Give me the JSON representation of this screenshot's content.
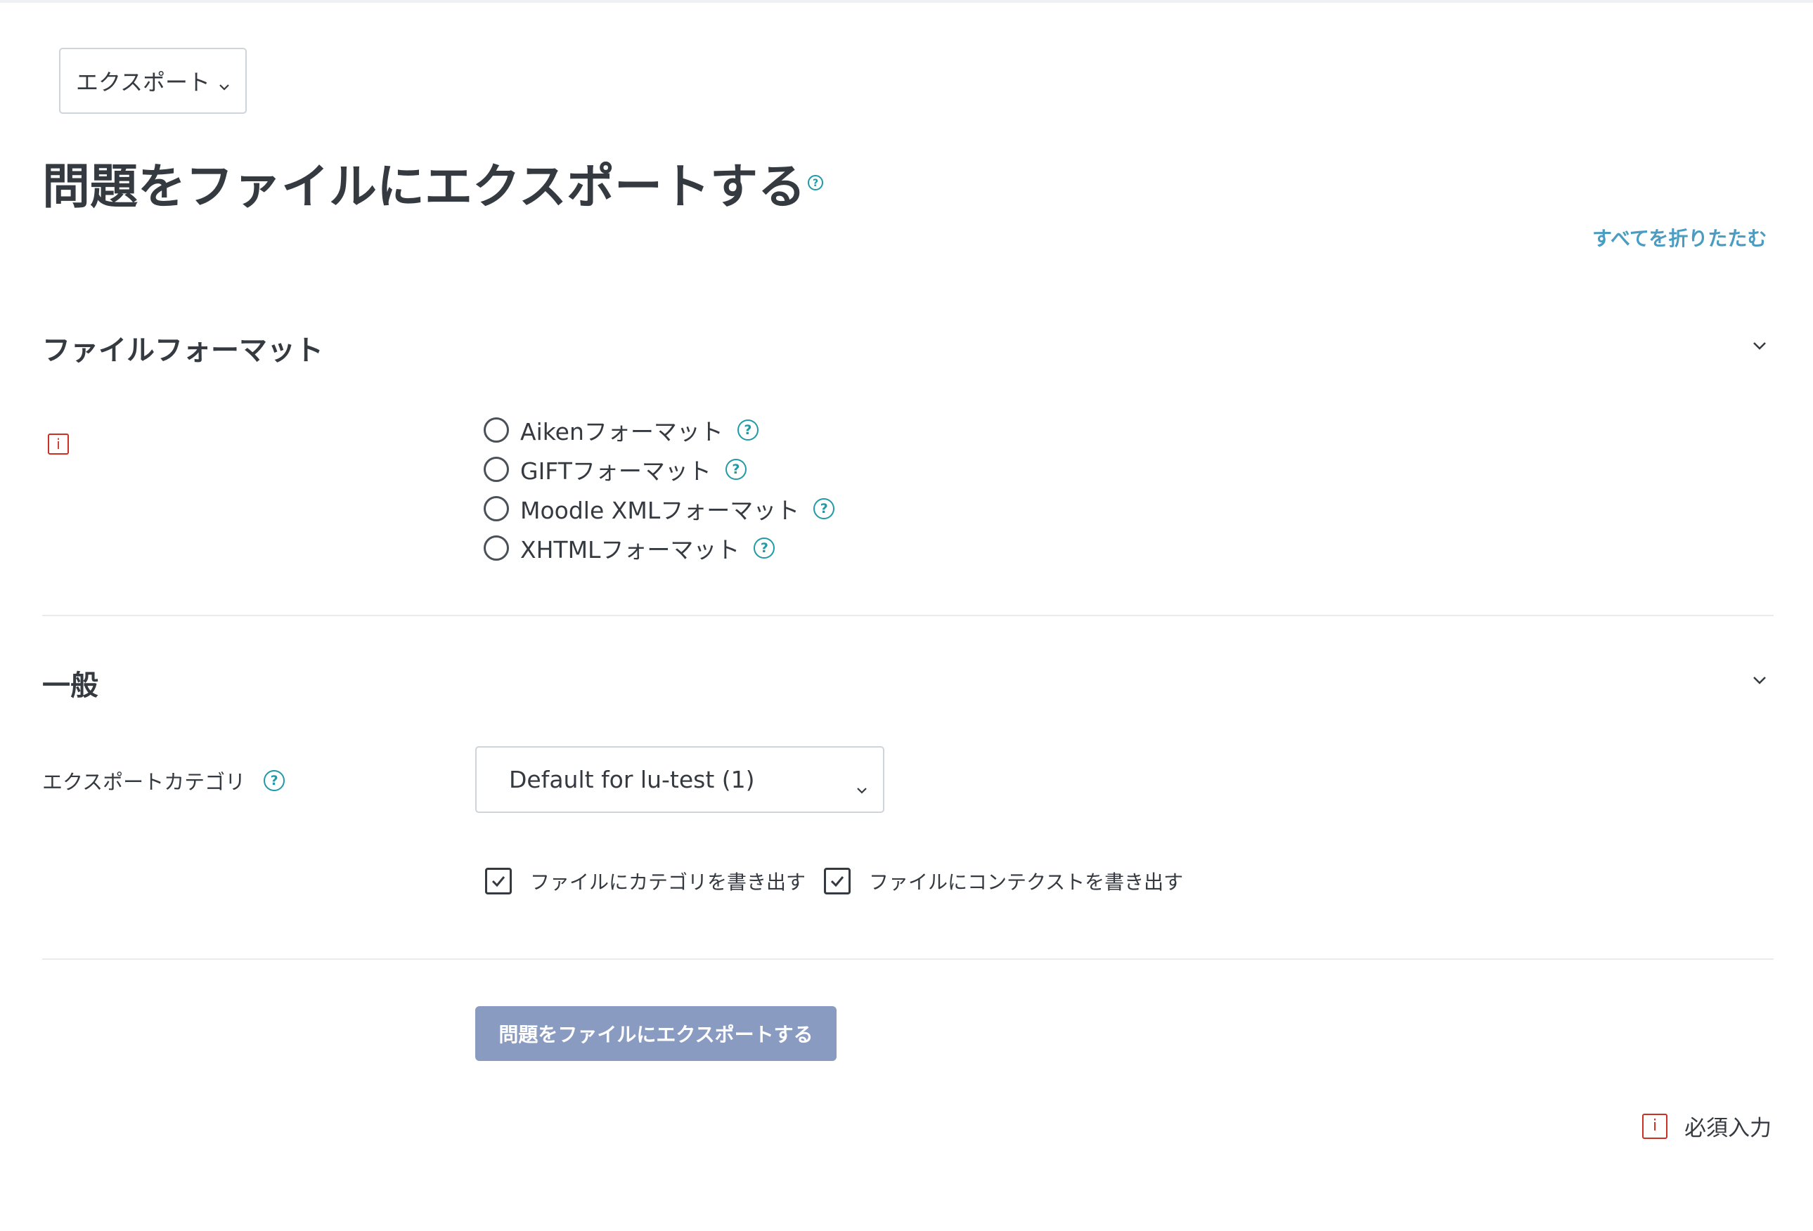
{
  "nav_select": {
    "value": "エクスポート"
  },
  "page": {
    "title": "問題をファイルにエクスポートする"
  },
  "collapse_all_label": "すべてを折りたたむ",
  "sections": {
    "file_format": {
      "heading": "ファイルフォーマット",
      "required_icon_text": "i",
      "options": [
        {
          "label": "Aikenフォーマット",
          "selected": false
        },
        {
          "label": "GIFTフォーマット",
          "selected": false
        },
        {
          "label": "Moodle XMLフォーマット",
          "selected": false
        },
        {
          "label": "XHTMLフォーマット",
          "selected": false
        }
      ]
    },
    "general": {
      "heading": "一般",
      "category_label": "エクスポートカテゴリ",
      "category_value": "Default for lu-test (1)",
      "checkboxes": [
        {
          "label": "ファイルにカテゴリを書き出す",
          "checked": true
        },
        {
          "label": "ファイルにコンテクストを書き出す",
          "checked": true
        }
      ]
    }
  },
  "submit_label": "問題をファイルにエクスポートする",
  "required_note": {
    "icon_text": "i",
    "label": "必須入力"
  },
  "help_glyph": "?",
  "colors": {
    "text": "#343a40",
    "link": "#4a9cc3",
    "help": "#1f9aa6",
    "required": "#ca3120",
    "button": "#8a9bc2",
    "border": "#ced4da"
  }
}
